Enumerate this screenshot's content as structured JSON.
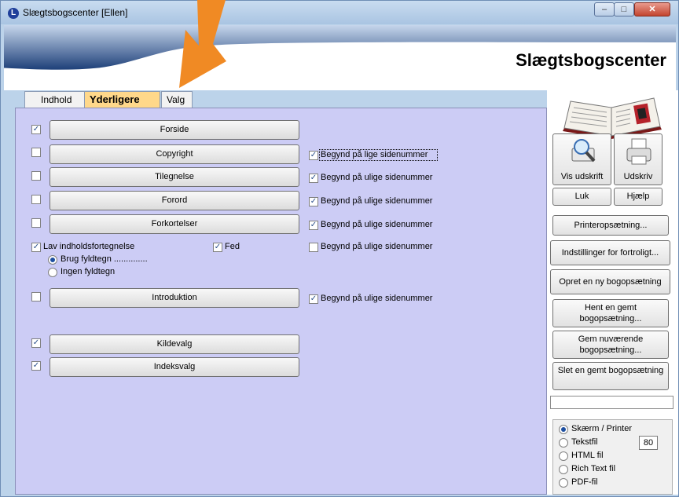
{
  "window": {
    "title": "Slægtsbogscenter [Ellen]",
    "app_icon_letter": "L",
    "minimize_symbol": "–",
    "maximize_symbol": "□",
    "close_symbol": "✕"
  },
  "header": {
    "heading": "Slægtsbogscenter"
  },
  "tabs": [
    {
      "label": "Indhold"
    },
    {
      "label": "Yderligere",
      "active": true
    },
    {
      "label": "Valg"
    }
  ],
  "sections": [
    {
      "label": "Forside",
      "checked": true
    },
    {
      "label": "Copyright",
      "checked": false,
      "option": {
        "label": "Begynd på lige sidenummer",
        "checked": true
      }
    },
    {
      "label": "Tilegnelse",
      "checked": false,
      "option": {
        "label": "Begynd på ulige sidenummer",
        "checked": true
      }
    },
    {
      "label": "Forord",
      "checked": false,
      "option": {
        "label": "Begynd på ulige sidenummer",
        "checked": true
      }
    },
    {
      "label": "Forkortelser",
      "checked": false,
      "option": {
        "label": "Begynd på ulige sidenummer",
        "checked": true
      }
    }
  ],
  "toc": {
    "label": "Lav indholdsfortegnelse",
    "checked": true,
    "bold_label": "Fed",
    "bold_checked": true,
    "option": {
      "label": "Begynd på ulige sidenummer",
      "checked": false
    },
    "fill_yes": "Brug fyldtegn ..............",
    "fill_no": "Ingen fyldtegn",
    "fill_selected": "fill_yes"
  },
  "introduction": {
    "label": "Introduktion",
    "checked": false,
    "option": {
      "label": "Begynd på ulige sidenummer",
      "checked": true
    }
  },
  "extra": [
    {
      "label": "Kildevalg",
      "checked": true
    },
    {
      "label": "Indeksvalg",
      "checked": true
    }
  ],
  "side": {
    "preview": "Vis udskrift",
    "print": "Udskriv",
    "close": "Luk",
    "help": "Hjælp",
    "printer_setup": "Printeropsætning...",
    "confidential": "Indstillinger for fortroligt...",
    "new_setup": "Opret en ny bogopsætning",
    "load_setup": "Hent en gemt bogopsætning...",
    "save_setup": "Gem nuværende bogopsætning...",
    "delete_setup": "Slet en gemt bogopsætning"
  },
  "output": {
    "options": [
      "Skærm / Printer",
      "Tekstfil",
      "HTML fil",
      "Rich Text fil",
      "PDF-fil"
    ],
    "selected": "Skærm / Printer",
    "text_width": "80"
  },
  "check_mark": "✓",
  "colors": {
    "accent_tab": "#ffd88a",
    "panel": "#ccccf5",
    "arrow": "#f08a24"
  }
}
